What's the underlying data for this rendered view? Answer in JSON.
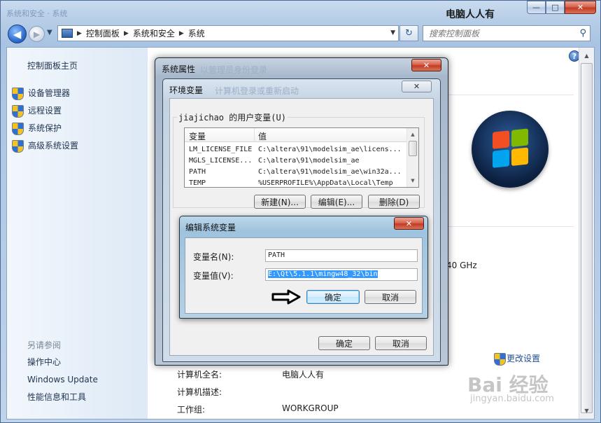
{
  "window": {
    "title": "电脑人人有",
    "ghost_title": "系统和安全 · 系统",
    "caption": {
      "minimize": "—",
      "maximize": "□",
      "close": "✕"
    }
  },
  "address_bar": {
    "crumbs": [
      "控制面板",
      "系统和安全",
      "系统"
    ],
    "search_placeholder": "搜索控制面板"
  },
  "left_pane": {
    "home": "控制面板主页",
    "links": [
      "设备管理器",
      "远程设置",
      "系统保护",
      "高级系统设置"
    ],
    "see_also_title": "另请参阅",
    "see_also": [
      "操作中心",
      "Windows Update",
      "性能信息和工具"
    ]
  },
  "main": {
    "ghz_fragment": "40 GHz",
    "change_settings": "更改设置",
    "info_rows": [
      {
        "key": "计算机全名:",
        "value": "电脑人人有"
      },
      {
        "key": "计算机描述:",
        "value": ""
      },
      {
        "key": "工作组:",
        "value": "WORKGROUP"
      }
    ]
  },
  "watermark": {
    "text": "Bai 经验",
    "sub": "jingyan.baidu.com"
  },
  "sys_props": {
    "title": "系统属性",
    "ghost": "以管理员身份登录"
  },
  "env_vars": {
    "title": "环境变量",
    "ghost": "计算机登录或重新启动",
    "user_group_label": "jiajichao 的用户变量(U)",
    "columns": [
      "变量",
      "值"
    ],
    "rows": [
      {
        "name": "LM_LICENSE_FILE",
        "value": "C:\\altera\\91\\modelsim_ae\\licens..."
      },
      {
        "name": "MGLS_LICENSE...",
        "value": "C:\\altera\\91\\modelsim_ae"
      },
      {
        "name": "PATH",
        "value": "C:\\altera\\91\\modelsim_ae\\win32a..."
      },
      {
        "name": "TEMP",
        "value": "%USERPROFILE%\\AppData\\Local\\Temp"
      }
    ],
    "buttons": {
      "new": "新建(N)...",
      "edit": "编辑(E)...",
      "delete": "删除(D)"
    },
    "ok": "确定",
    "cancel": "取消"
  },
  "edit_var": {
    "title": "编辑系统变量",
    "name_label": "变量名(N):",
    "name_value": "PATH",
    "value_label": "变量值(V):",
    "value_value": "E:\\Qt\\5.1.1\\mingw48_32\\bin",
    "ok": "确定",
    "cancel": "取消"
  },
  "icons": {
    "back": "back-arrow-icon",
    "forward": "forward-arrow-icon",
    "search": "search-icon",
    "refresh": "refresh-icon",
    "help": "help-icon",
    "shield": "uac-shield-icon",
    "pointer": "arrow-pointer-icon",
    "logo": "windows-logo-icon"
  },
  "colors": {
    "link": "#1f3450",
    "selection": "#3399ff",
    "close_red": "#c33b22"
  }
}
